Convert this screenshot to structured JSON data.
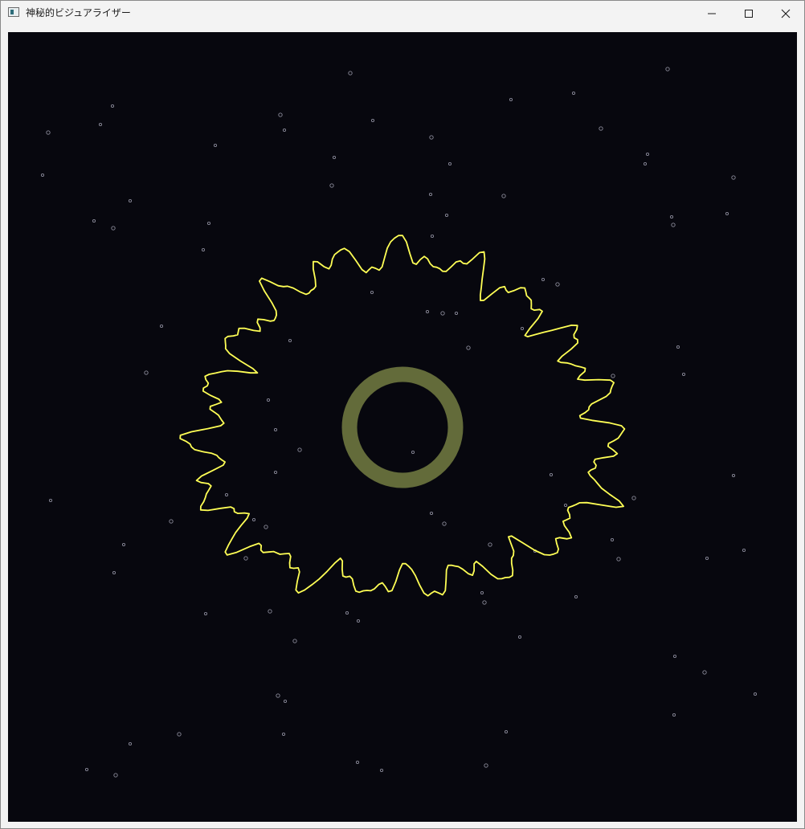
{
  "window": {
    "title": "神秘的ビジュアライザー",
    "icon": "app-window-icon",
    "controls": {
      "minimize_icon": "minimize-icon",
      "maximize_icon": "maximize-icon",
      "close_icon": "close-icon"
    }
  },
  "visualizer": {
    "background_color": "#07070e",
    "star_color": "#8a8a99",
    "waveform_color": "#ffff55",
    "ring_color": "#636b3a"
  }
}
